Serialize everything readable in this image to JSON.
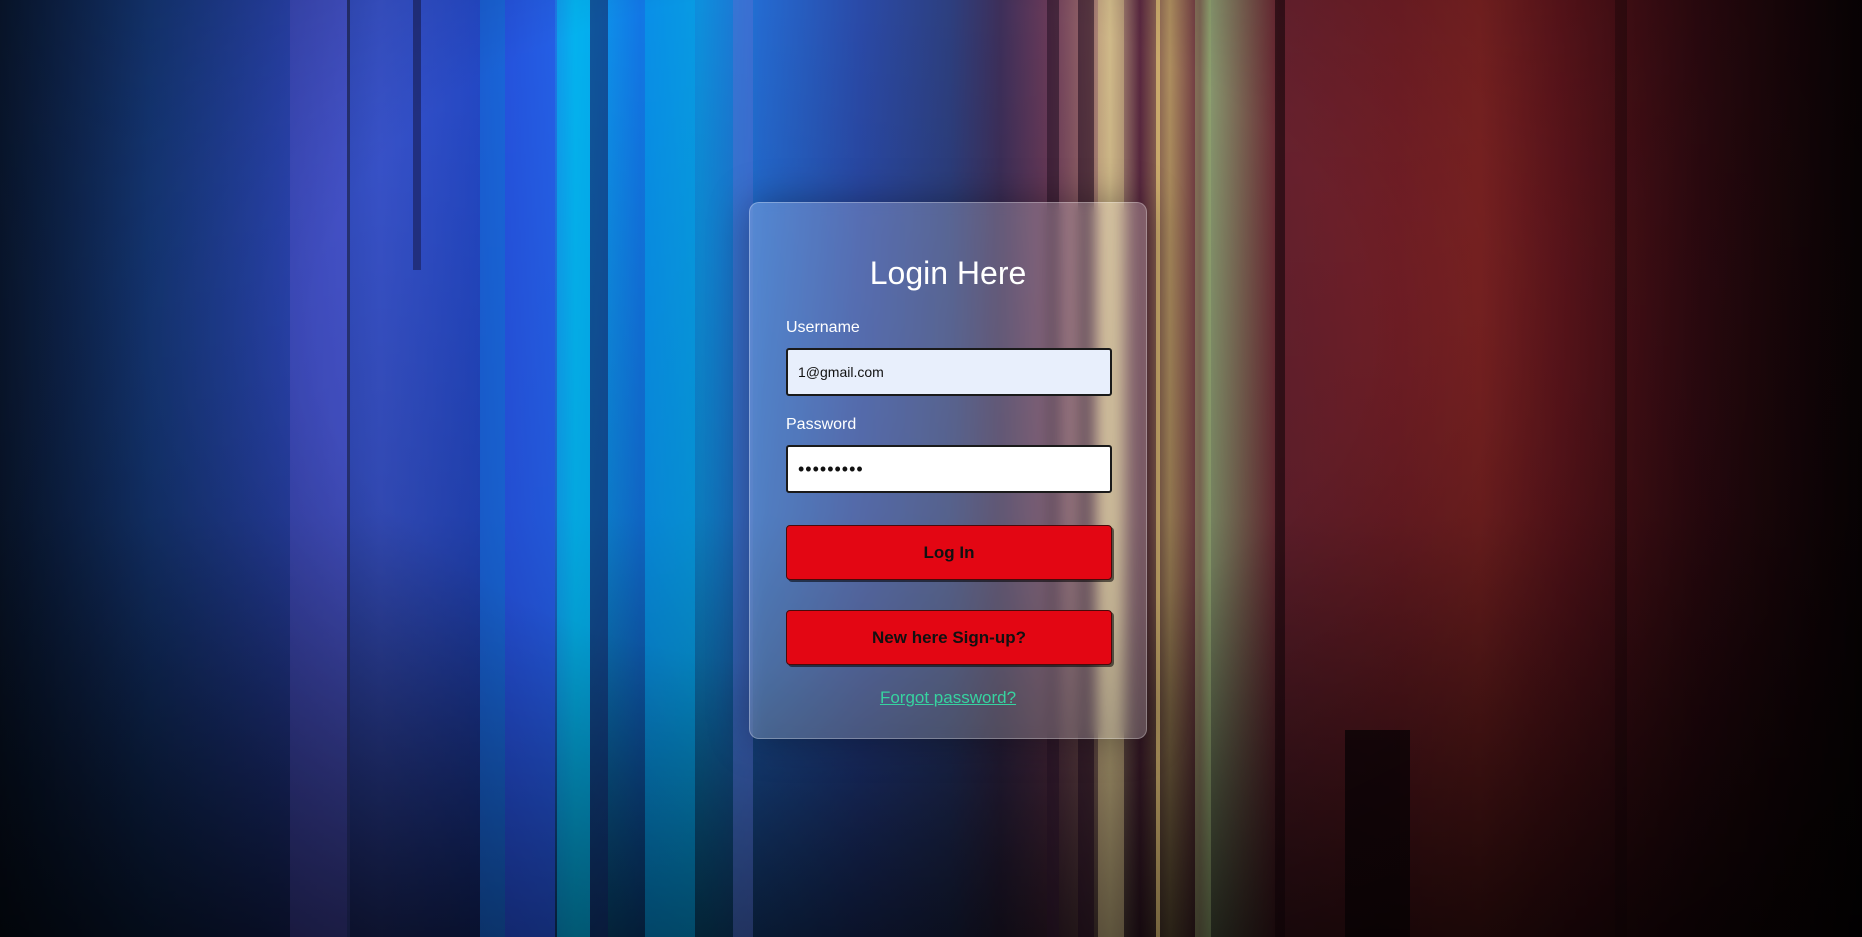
{
  "login_form": {
    "title": "Login Here",
    "username_label": "Username",
    "username_value": "1@gmail.com",
    "password_label": "Password",
    "password_value": "•••••••••",
    "login_button": "Log In",
    "signup_button": "New here Sign-up?",
    "forgot_link": "Forgot password?"
  },
  "colors": {
    "button": "#e30613",
    "link": "#37d3a0",
    "username_field_bg": "#e8effc"
  }
}
